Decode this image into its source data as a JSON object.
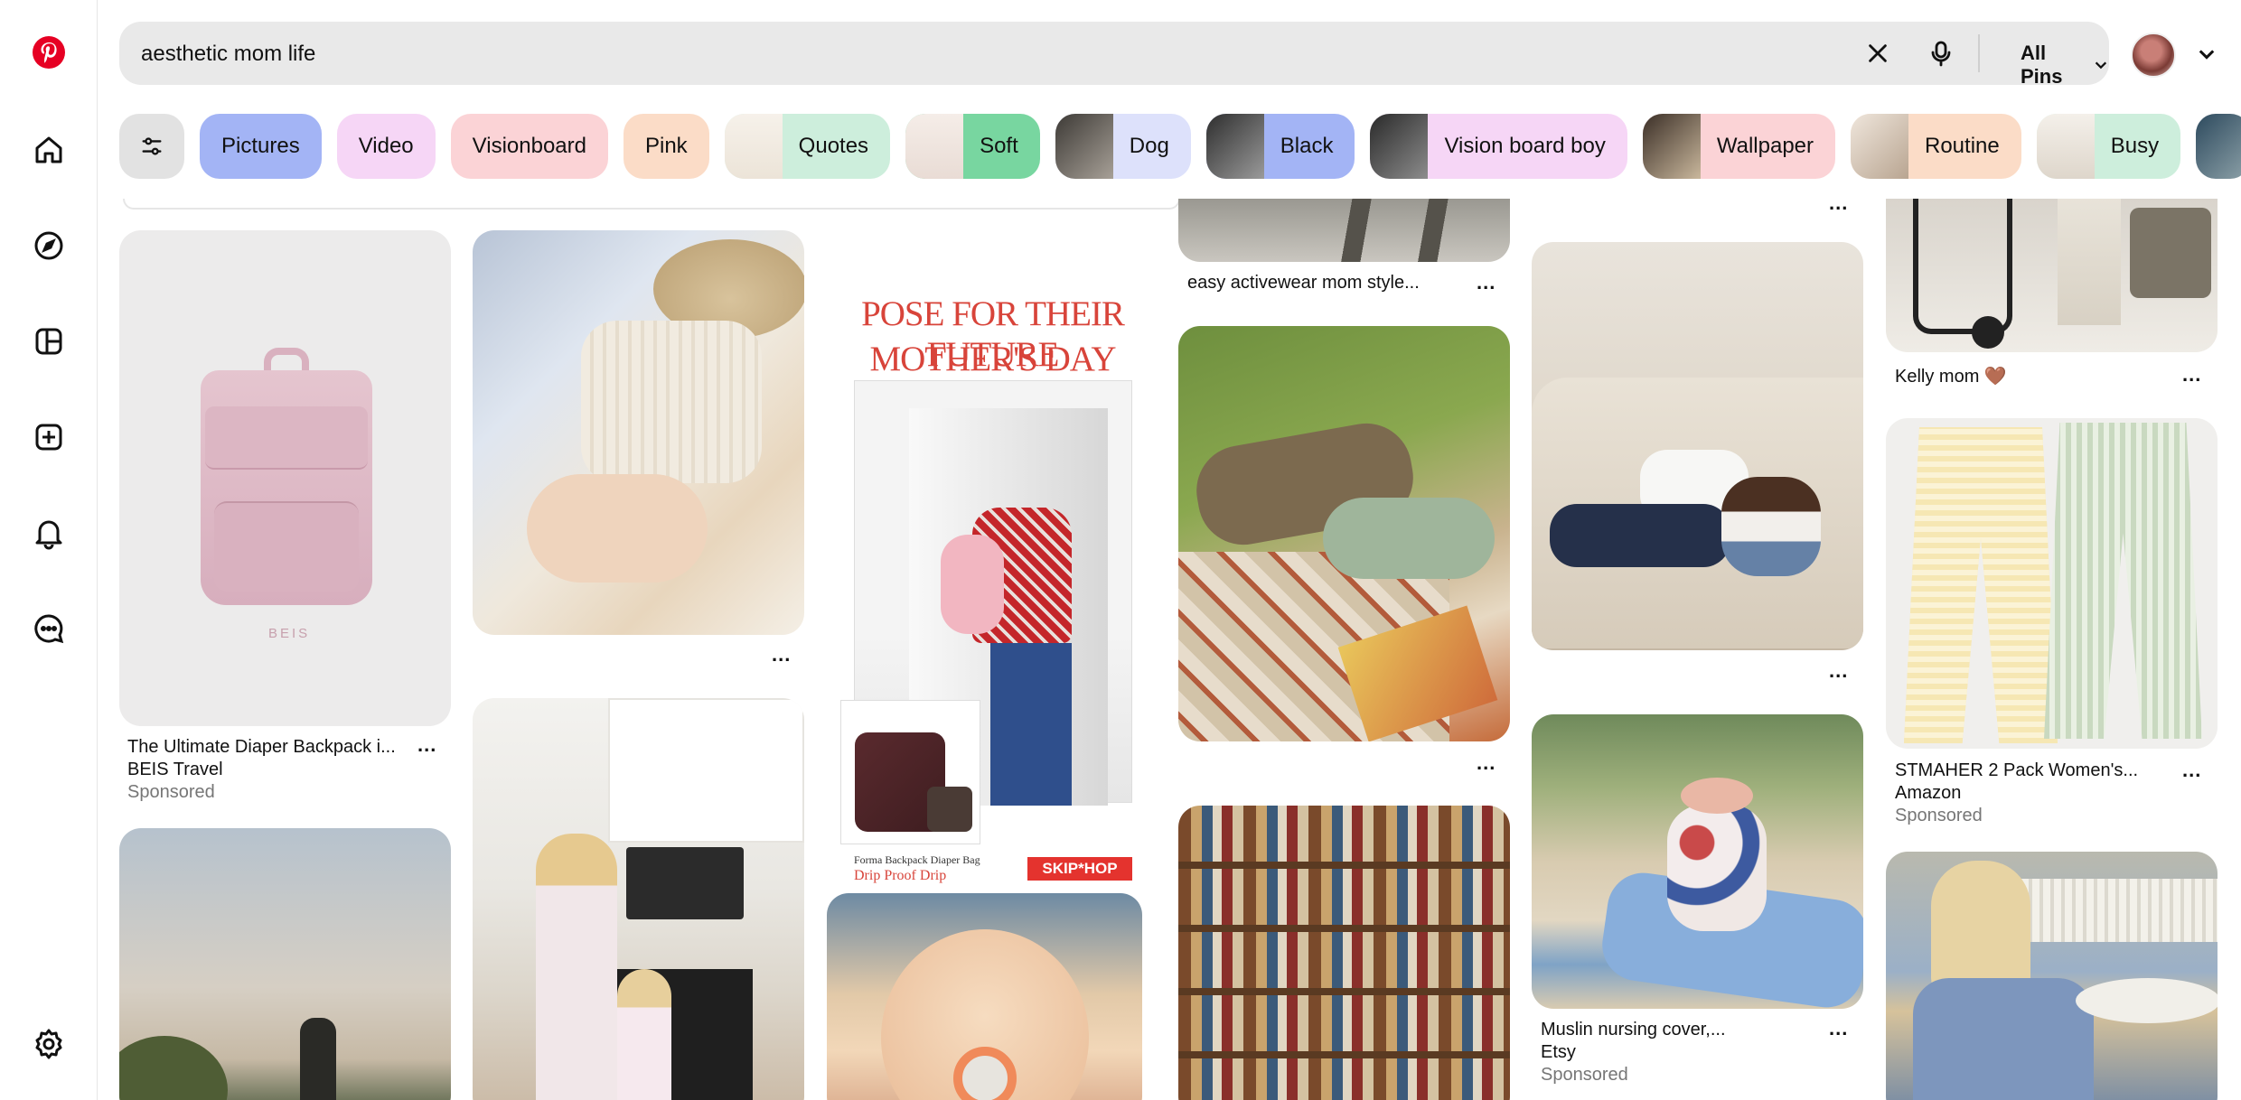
{
  "search": {
    "query": "aesthetic mom life",
    "scope": "All Pins"
  },
  "chips": [
    {
      "label": "Pictures",
      "bg": "#a3b4f5"
    },
    {
      "label": "Video",
      "bg": "#f6d6f6"
    },
    {
      "label": "Visionboard",
      "bg": "#fbd3d6"
    },
    {
      "label": "Pink",
      "bg": "#fbdcc7"
    },
    {
      "label": "Quotes",
      "bg": "#cdeedc"
    },
    {
      "label": "Soft",
      "bg": "#78d6a0"
    },
    {
      "label": "Dog",
      "bg": "#dde1fb"
    },
    {
      "label": "Black",
      "bg": "#a3b4f5"
    },
    {
      "label": "Vision board boy",
      "bg": "#f6d6f6"
    },
    {
      "label": "Wallpaper",
      "bg": "#fbd3d6"
    },
    {
      "label": "Routine",
      "bg": "#fbdcc7"
    },
    {
      "label": "Busy",
      "bg": "#cdeedc"
    }
  ],
  "pins": {
    "backpack": {
      "title": "The Ultimate Diaper Backpack i...",
      "source": "BEIS Travel",
      "sponsored": "Sponsored",
      "brand": "BEIS"
    },
    "poster": {
      "headline_1": "POSE FOR THEIR FUTURE",
      "headline_2": "MOTHER'S DAY POST",
      "product_1": "Forma Backpack Diaper Bag",
      "product_2": "Drip Proof Drip",
      "brand": "SKIP*HOP"
    },
    "activewear": {
      "title": "easy activewear mom style..."
    },
    "kelly": {
      "title": "Kelly mom 🤎"
    },
    "pants": {
      "title": "STMAHER 2 Pack Women's...",
      "source": "Amazon",
      "sponsored": "Sponsored"
    },
    "muslin": {
      "title": "Muslin nursing cover,...",
      "source": "Etsy",
      "sponsored": "Sponsored"
    },
    "more": "..."
  },
  "colors": {
    "brand": "#e60023",
    "search_bg": "#e9e9e9",
    "filter_chip": "#e2e2e2",
    "sponsored_text": "#767676"
  }
}
